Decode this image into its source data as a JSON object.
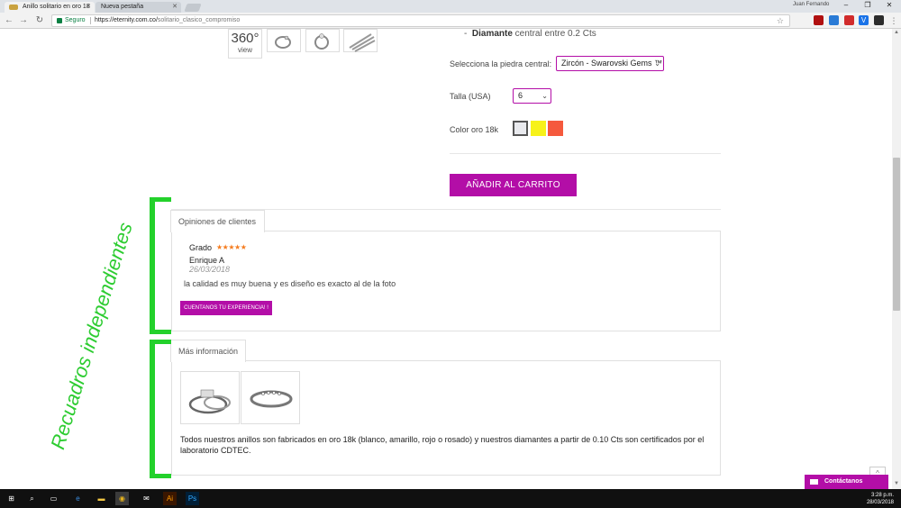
{
  "browser": {
    "tabs": [
      {
        "label": "Anillo solitario en oro 18",
        "active": true
      },
      {
        "label": "Nueva pestaña",
        "active": false
      }
    ],
    "profile_name": "Juan Fernando",
    "address": {
      "secure_label": "Seguro",
      "domain": "https://eternity.com.co/",
      "path": "solitario_clasico_compromiso"
    }
  },
  "product": {
    "thumb_360": {
      "big": "360°",
      "small": "view"
    },
    "diamond_label": "Diamante",
    "diamond_text": " central entre 0.2 Cts",
    "stone_label": "Selecciona la piedra central:",
    "stone_value": "Zircón - Swarovski Gems ™",
    "size_label": "Talla (USA)",
    "size_value": "6",
    "color_label": "Color oro 18k",
    "colors": [
      "#e9eaee",
      "#f7f21a",
      "#f5593d"
    ],
    "add_to_cart": "AÑADIR AL CARRITO"
  },
  "reviews": {
    "tab_label": "Opiniones de clientes",
    "grade_label": "Grado",
    "stars": "★★★★★",
    "reviewer": "Enrique A",
    "date": "26/03/2018",
    "text": "la calidad es muy buena y es diseño es exacto al de la foto",
    "button": "CUENTANOS TU EXPERIENCIA! !"
  },
  "more_info": {
    "tab_label": "Más información",
    "text": "Todos nuestros anillos son fabricados en oro 18k (blanco, amarillo, rojo o rosado) y nuestros diamantes a partir de 0.10 Cts son certificados por el laboratorio CDTEC."
  },
  "annotation": {
    "text": "Recuadros independientes",
    "color": "#2dcc31"
  },
  "widgets": {
    "back_top": "^",
    "contact": "Contáctanos"
  },
  "taskbar": {
    "time": "3:28 p.m.",
    "date": "28/03/2018",
    "app_labels": {
      "illustrator": "Ai",
      "photoshop": "Ps"
    }
  },
  "colors": {
    "accent": "#b30ea7",
    "star": "#f57c1f",
    "secure": "#0b8043"
  }
}
